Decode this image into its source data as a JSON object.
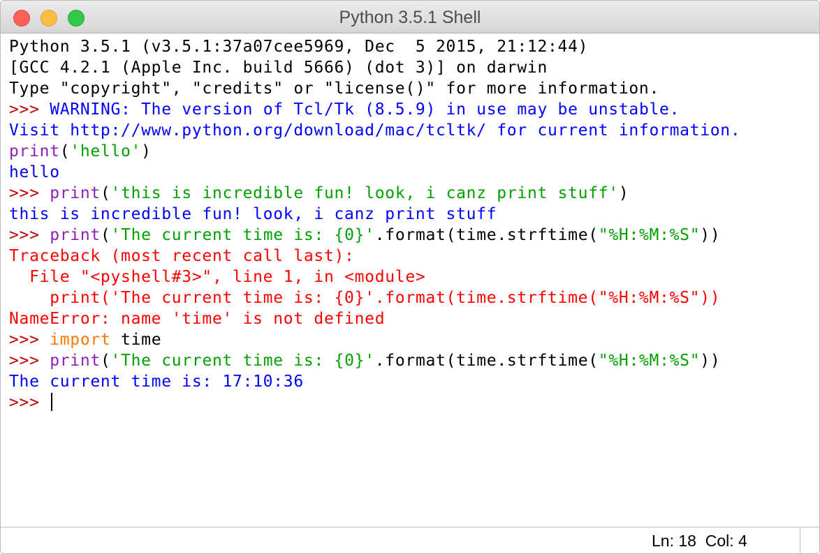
{
  "window": {
    "title": "Python 3.5.1 Shell"
  },
  "shell": {
    "lines": [
      [
        {
          "t": "Python 3.5.1 (v3.5.1:37a07cee5969, Dec  5 2015, 21:12:44)",
          "c": "plain"
        }
      ],
      [
        {
          "t": "[GCC 4.2.1 (Apple Inc. build 5666) (dot 3)] on darwin",
          "c": "plain"
        }
      ],
      [
        {
          "t": "Type \"copyright\", \"credits\" or \"license()\" for more information.",
          "c": "plain"
        }
      ],
      [
        {
          "t": ">>> ",
          "c": "prompt"
        },
        {
          "t": "WARNING: The version of Tcl/Tk (8.5.9) in use may be unstable.",
          "c": "warn"
        }
      ],
      [
        {
          "t": "Visit http://www.python.org/download/mac/tcltk/ for current information.",
          "c": "warn"
        }
      ],
      [
        {
          "t": "print",
          "c": "kw"
        },
        {
          "t": "(",
          "c": "plain"
        },
        {
          "t": "'hello'",
          "c": "str"
        },
        {
          "t": ")",
          "c": "plain"
        }
      ],
      [
        {
          "t": "hello",
          "c": "out"
        }
      ],
      [
        {
          "t": ">>> ",
          "c": "prompt"
        },
        {
          "t": "print",
          "c": "kw"
        },
        {
          "t": "(",
          "c": "plain"
        },
        {
          "t": "'this is incredible fun! look, i canz print stuff'",
          "c": "str"
        },
        {
          "t": ")",
          "c": "plain"
        }
      ],
      [
        {
          "t": "this is incredible fun! look, i canz print stuff",
          "c": "out"
        }
      ],
      [
        {
          "t": ">>> ",
          "c": "prompt"
        },
        {
          "t": "print",
          "c": "kw"
        },
        {
          "t": "(",
          "c": "plain"
        },
        {
          "t": "'The current time is: {0}'",
          "c": "str"
        },
        {
          "t": ".format(time.strftime(",
          "c": "plain"
        },
        {
          "t": "\"%H:%M:%S\"",
          "c": "str"
        },
        {
          "t": "))",
          "c": "plain"
        }
      ],
      [
        {
          "t": "Traceback (most recent call last):",
          "c": "err"
        }
      ],
      [
        {
          "t": "  File \"<pyshell#3>\", line 1, in <module>",
          "c": "err"
        }
      ],
      [
        {
          "t": "    print('The current time is: {0}'.format(time.strftime(\"%H:%M:%S\"))",
          "c": "err"
        }
      ],
      [
        {
          "t": "NameError: name 'time' is not defined",
          "c": "err"
        }
      ],
      [
        {
          "t": ">>> ",
          "c": "prompt"
        },
        {
          "t": "import",
          "c": "imp"
        },
        {
          "t": " time",
          "c": "plain"
        }
      ],
      [
        {
          "t": ">>> ",
          "c": "prompt"
        },
        {
          "t": "print",
          "c": "kw"
        },
        {
          "t": "(",
          "c": "plain"
        },
        {
          "t": "'The current time is: {0}'",
          "c": "str"
        },
        {
          "t": ".format(time.strftime(",
          "c": "plain"
        },
        {
          "t": "\"%H:%M:%S\"",
          "c": "str"
        },
        {
          "t": "))",
          "c": "plain"
        }
      ],
      [
        {
          "t": "The current time is: 17:10:36",
          "c": "out"
        }
      ],
      [
        {
          "t": ">>> ",
          "c": "prompt"
        }
      ]
    ]
  },
  "status": {
    "ln_label": "Ln: 18",
    "col_label": "Col: 4"
  },
  "colors": {
    "prompt": "#c00000",
    "output": "#0000ff",
    "keyword": "#8e1fb8",
    "string": "#00a000",
    "error": "#ff0000",
    "import": "#ff7700"
  }
}
